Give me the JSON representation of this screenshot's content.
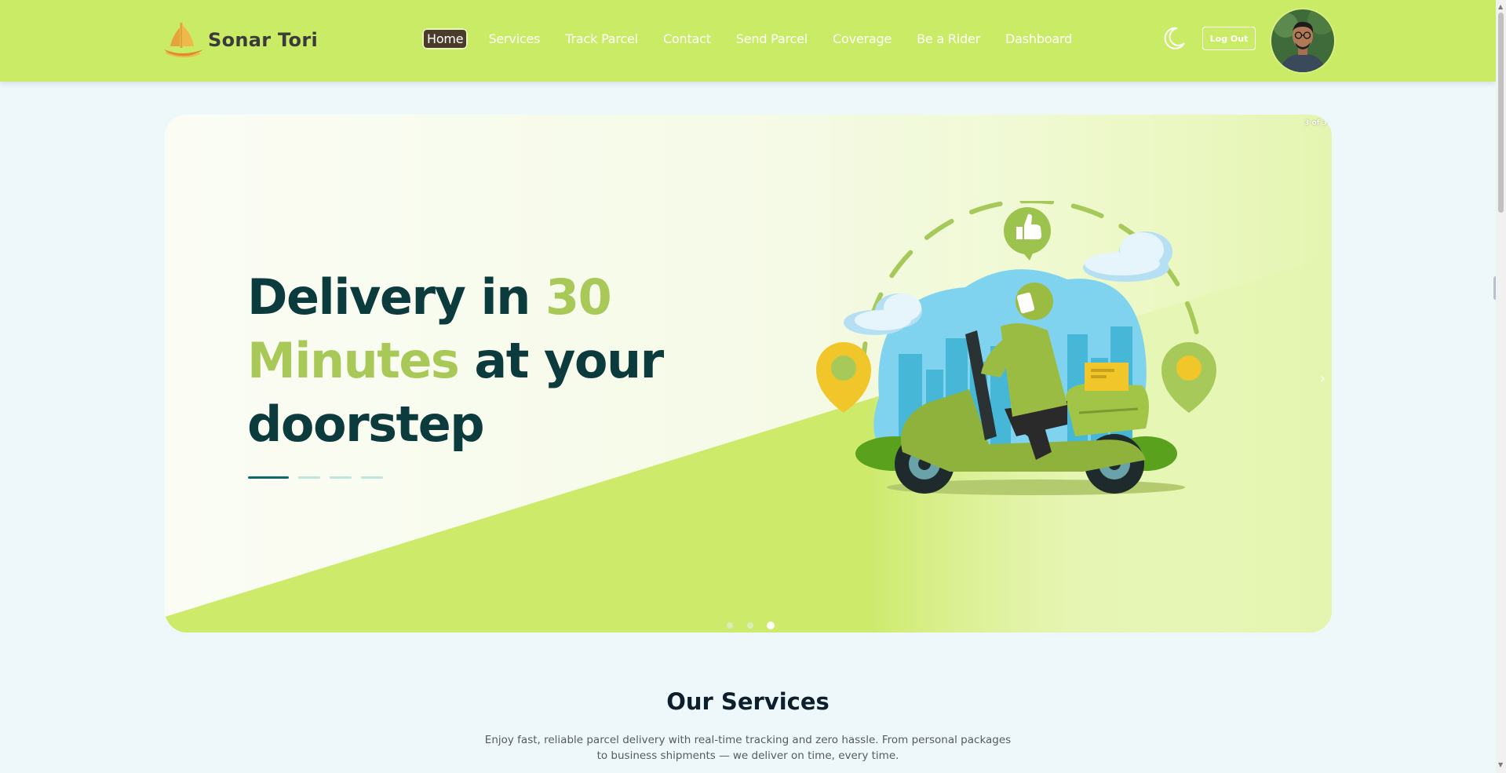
{
  "brand": {
    "name": "Sonar Tori"
  },
  "nav": {
    "items": [
      {
        "label": "Home",
        "active": true
      },
      {
        "label": "Services",
        "active": false
      },
      {
        "label": "Track Parcel",
        "active": false
      },
      {
        "label": "Contact",
        "active": false
      },
      {
        "label": "Send Parcel",
        "active": false
      },
      {
        "label": "Coverage",
        "active": false
      },
      {
        "label": "Be a Rider",
        "active": false
      },
      {
        "label": "Dashboard",
        "active": false
      }
    ],
    "theme_toggle_icon": "moon-icon",
    "logout_label": "Log Out"
  },
  "hero": {
    "title_part1": "Delivery in ",
    "title_accent1": "30",
    "title_accent2": "Minutes",
    "title_part2": " at your doorstep",
    "slide_counter": "3 of 3",
    "total_slides": 3,
    "active_slide": 3,
    "next_icon": "chevron-right-icon"
  },
  "services": {
    "title": "Our Services",
    "description": "Enjoy fast, reliable parcel delivery with real-time tracking and zero hassle. From personal packages to business shipments — we deliver on time, every time."
  },
  "colors": {
    "header_bg": "#caeb66",
    "accent_green": "#a8c858",
    "dark_teal": "#0c3b3e",
    "active_nav_bg": "#4b3b2b",
    "page_bg": "#eef8fb"
  }
}
